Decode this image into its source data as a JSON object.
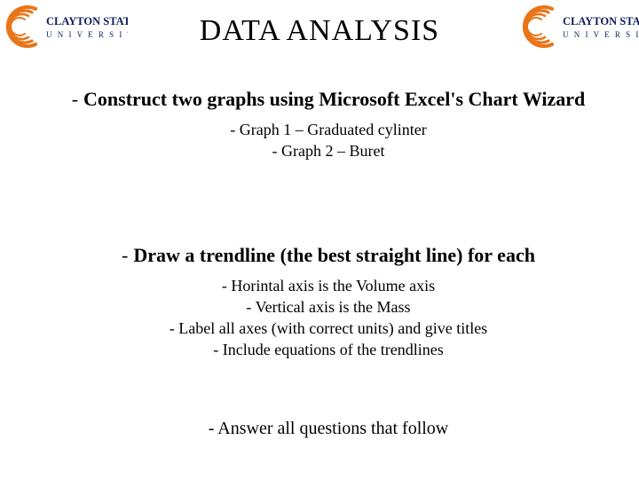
{
  "logo": {
    "line1": "CLAYTON STATE",
    "line2": "U N I V E R S I T Y",
    "swoosh_color": "#e97519",
    "text_color": "#0c1c5c"
  },
  "title": "DATA ANALYSIS",
  "section1": {
    "lead_dash": "-",
    "lead": "Construct two graphs using Microsoft Excel's Chart Wizard",
    "sub1": "- Graph 1 – Graduated cylinter",
    "sub2": "- Graph 2 – Buret"
  },
  "section2": {
    "lead_dash": "-",
    "lead": "Draw a trendline (the best straight line) for each",
    "sub1": "- Horintal axis is the Volume axis",
    "sub2": "- Vertical axis is the Mass",
    "sub3": "- Label all axes (with correct units) and give titles",
    "sub4": "- Include equations of the trendlines"
  },
  "section3": {
    "line": "- Answer all questions that follow"
  }
}
